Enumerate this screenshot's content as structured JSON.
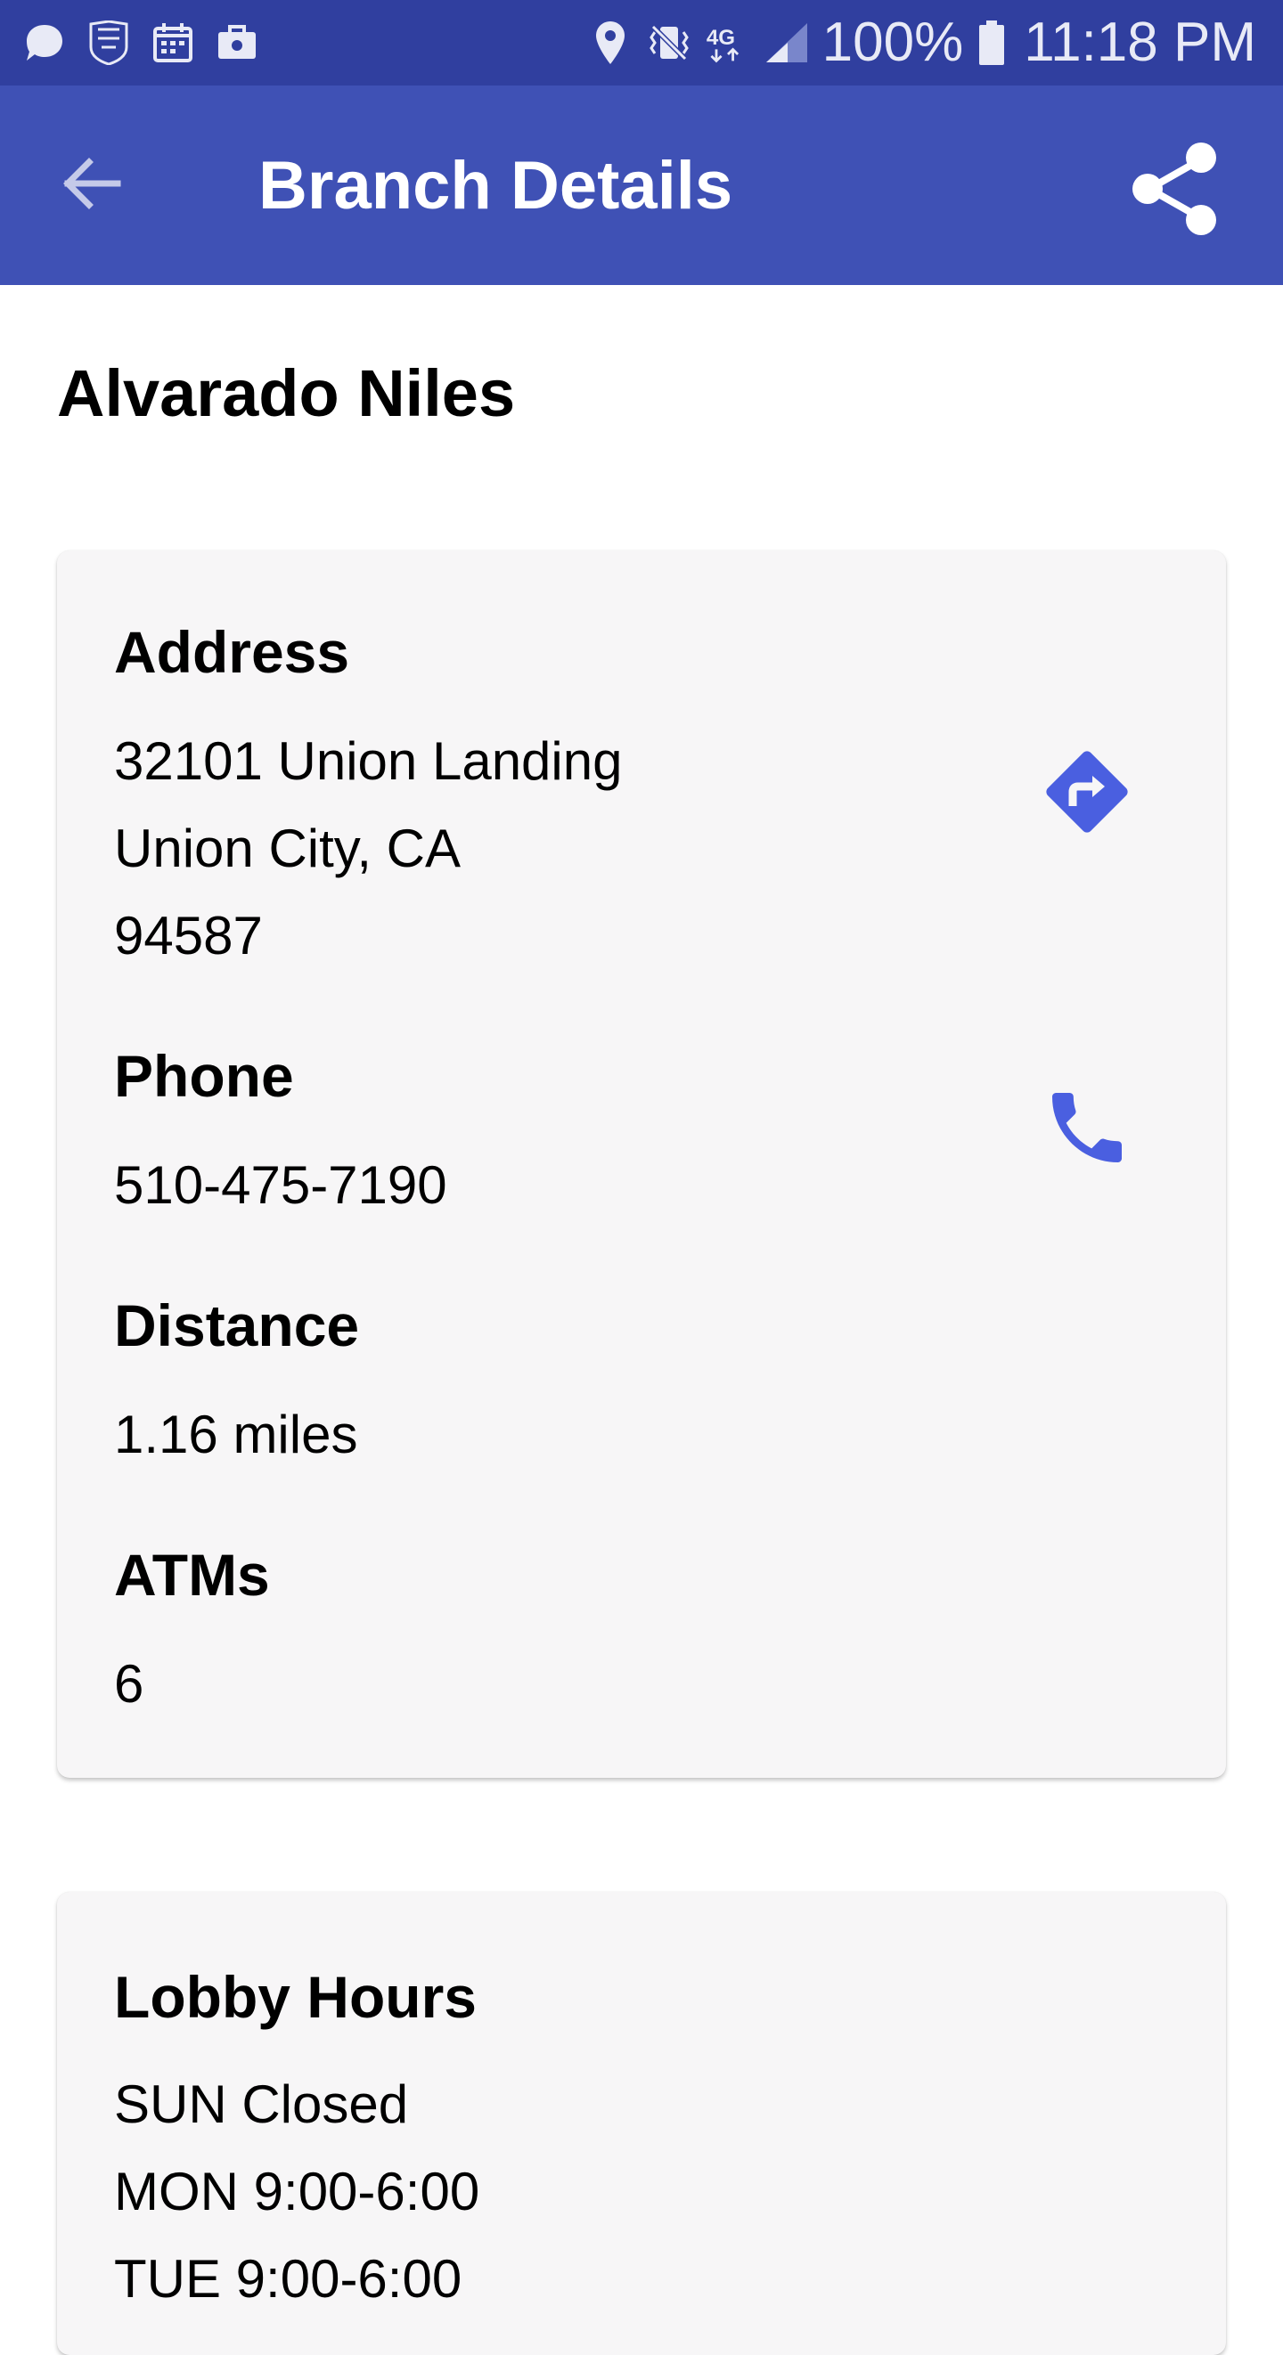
{
  "status_bar": {
    "battery_percent": "100%",
    "time": "11:18 PM",
    "left_icons": [
      "chat-bubble-icon",
      "nfl-icon",
      "calendar-icon",
      "briefcase-icon"
    ],
    "right_icons": [
      "location-icon",
      "vibrate-icon",
      "lte-icon",
      "signal-icon",
      "battery-icon"
    ]
  },
  "app_bar": {
    "title": "Branch Details",
    "back_icon": "arrow-back-icon",
    "share_icon": "share-icon"
  },
  "branch": {
    "name": "Alvarado Niles"
  },
  "info_card": {
    "address_label": "Address",
    "address_line1": "32101 Union Landing",
    "address_line2": "Union City, CA",
    "address_line3": "94587",
    "phone_label": "Phone",
    "phone_value": "510-475-7190",
    "distance_label": "Distance",
    "distance_value": "1.16 miles",
    "atms_label": "ATMs",
    "atms_value": "6",
    "directions_icon": "directions-icon",
    "call_icon": "phone-icon"
  },
  "hours_card": {
    "label": "Lobby Hours",
    "rows": [
      "SUN Closed",
      "MON 9:00-6:00",
      "TUE 9:00-6:00"
    ]
  },
  "colors": {
    "status_bar": "#303f9f",
    "app_bar": "#3f51b5",
    "accent": "#4a5fe0",
    "card_bg": "#f7f6f7"
  }
}
